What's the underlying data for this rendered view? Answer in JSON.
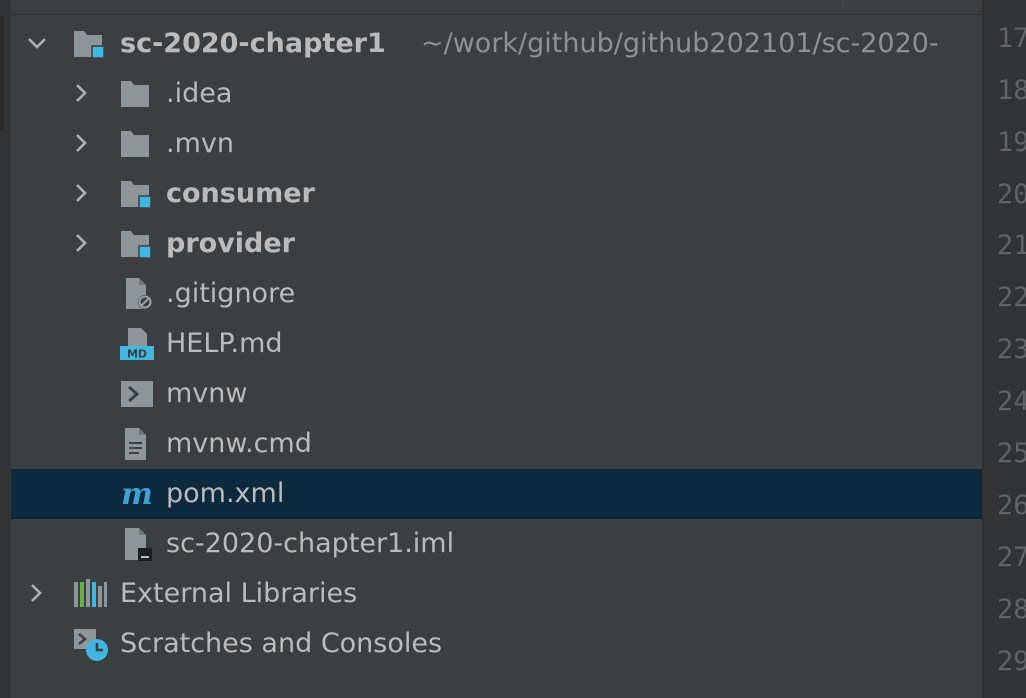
{
  "project_tree": {
    "root": {
      "name": "sc-2020-chapter1",
      "path": "~/work/github/github202101/sc-2020-"
    },
    "items": [
      {
        "label": ".idea"
      },
      {
        "label": ".mvn"
      },
      {
        "label": "consumer"
      },
      {
        "label": "provider"
      },
      {
        "label": ".gitignore"
      },
      {
        "label": "HELP.md"
      },
      {
        "label": "mvnw"
      },
      {
        "label": "mvnw.cmd"
      },
      {
        "label": "pom.xml"
      },
      {
        "label": "sc-2020-chapter1.iml"
      }
    ],
    "external_libraries": "External Libraries",
    "scratches": "Scratches and Consoles",
    "selected_item": "pom.xml"
  },
  "icons": {
    "md_badge": "MD",
    "maven_glyph": "m"
  },
  "editor_gutter": {
    "line_numbers": [
      "17",
      "18",
      "19",
      "20",
      "21",
      "22",
      "23",
      "24",
      "25",
      "26",
      "27",
      "28",
      "29"
    ]
  },
  "colors": {
    "background": "#3c3f41",
    "selection": "#0d293e",
    "module_badge": "#40b6e0",
    "text": "#bbbbbb",
    "path_text": "#8f9295"
  }
}
